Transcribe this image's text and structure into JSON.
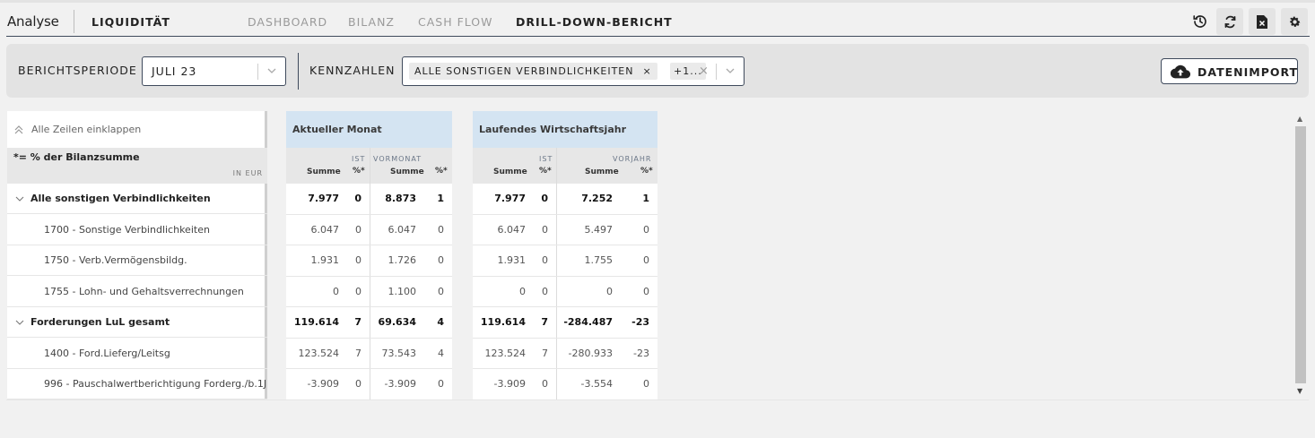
{
  "header": {
    "app_title": "Analyse",
    "section_title": "LIQUIDITÄT",
    "tabs": [
      {
        "label": "DASHBOARD",
        "active": false
      },
      {
        "label": "BILANZ",
        "active": false
      },
      {
        "label": "CASH FLOW",
        "active": false
      },
      {
        "label": "DRILL-DOWN-BERICHT",
        "active": true
      }
    ],
    "icons": [
      "history-icon",
      "refresh-icon",
      "excel-export-icon",
      "settings-icon"
    ]
  },
  "filters": {
    "period_label": "BERICHTSPERIODE",
    "period_value": "JULI 23",
    "kpi_label": "KENNZAHLEN",
    "kpi_chip": "ALLE SONSTIGEN VERBINDLICHKEITEN",
    "kpi_chip_remove": "×",
    "kpi_more": "+1...",
    "kpi_clear": "×",
    "import_label": "DATENIMPORT"
  },
  "table": {
    "collapse_label": "Alle Zeilen einklappen",
    "legend": "*= % der Bilanzsumme",
    "unit": "IN EUR",
    "blocks": [
      {
        "title": "Aktueller Monat",
        "group1": "IST",
        "group2": "VORMONAT",
        "col_sum": "Summe",
        "col_pct": "%*"
      },
      {
        "title": "Laufendes Wirtschaftsjahr",
        "group1": "IST",
        "group2": "VORJAHR",
        "col_sum": "Summe",
        "col_pct": "%*"
      }
    ],
    "rows": [
      {
        "label": "Alle sonstigen Verbindlichkeiten",
        "group": true,
        "m": [
          "7.977",
          "0",
          "8.873",
          "1"
        ],
        "y": [
          "7.977",
          "0",
          "7.252",
          "1"
        ]
      },
      {
        "label": "1700 - Sonstige Verbindlichkeiten",
        "group": false,
        "m": [
          "6.047",
          "0",
          "6.047",
          "0"
        ],
        "y": [
          "6.047",
          "0",
          "5.497",
          "0"
        ]
      },
      {
        "label": "1750 - Verb.Vermögensbildg.",
        "group": false,
        "m": [
          "1.931",
          "0",
          "1.726",
          "0"
        ],
        "y": [
          "1.931",
          "0",
          "1.755",
          "0"
        ]
      },
      {
        "label": "1755 - Lohn- und Gehaltsverrechnungen",
        "group": false,
        "m": [
          "0",
          "0",
          "1.100",
          "0"
        ],
        "y": [
          "0",
          "0",
          "0",
          "0"
        ]
      },
      {
        "label": "Forderungen LuL gesamt",
        "group": true,
        "m": [
          "119.614",
          "7",
          "69.634",
          "4"
        ],
        "y": [
          "119.614",
          "7",
          "-284.487",
          "-23"
        ]
      },
      {
        "label": "1400 - Ford.Lieferg/Leitsg",
        "group": false,
        "m": [
          "123.524",
          "7",
          "73.543",
          "4"
        ],
        "y": [
          "123.524",
          "7",
          "-280.933",
          "-23"
        ]
      },
      {
        "label": "996 - Pauschalwertberichtigung Forderg./b.1J",
        "group": false,
        "m": [
          "-3.909",
          "0",
          "-3.909",
          "0"
        ],
        "y": [
          "-3.909",
          "0",
          "-3.554",
          "0"
        ]
      }
    ]
  },
  "scrollbar": {
    "up": "▲",
    "down": "▼"
  }
}
